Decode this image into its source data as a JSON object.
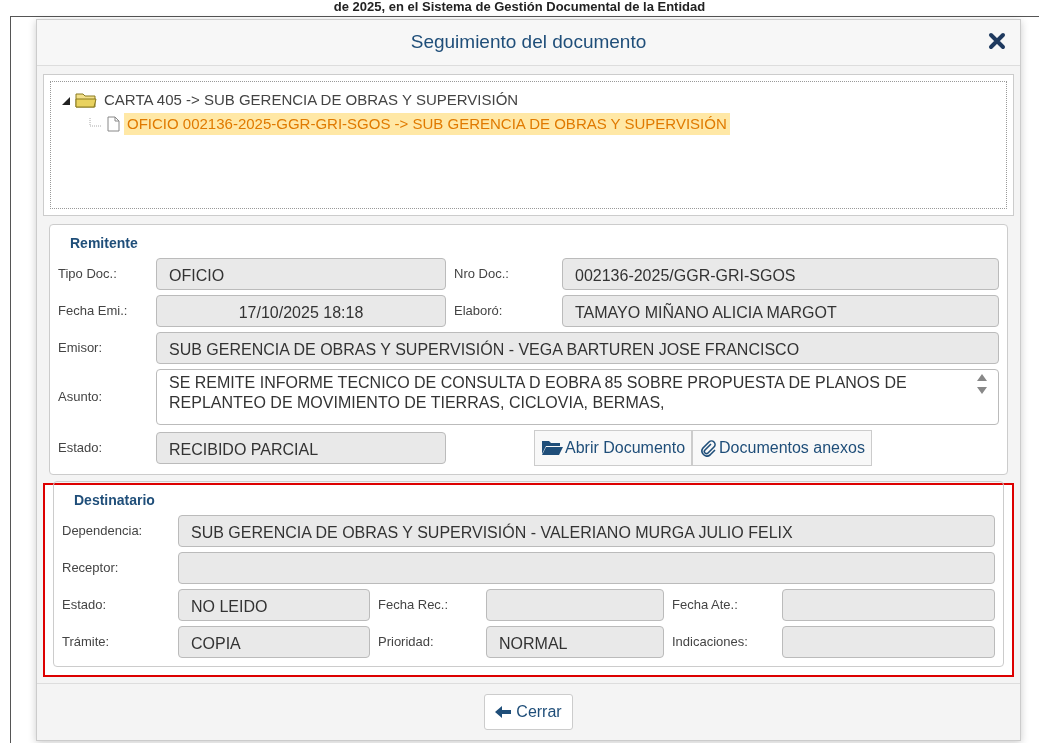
{
  "page_heading": "de 2025, en el Sistema de Gestión Documental de la Entidad",
  "modal": {
    "title": "Seguimiento del documento"
  },
  "tree": [
    {
      "label": "CARTA 405 -> SUB GERENCIA DE OBRAS Y SUPERVISIÓN",
      "expanded": true,
      "selected": false,
      "children": [
        {
          "label": "OFICIO 002136-2025-GGR-GRI-SGOS -> SUB GERENCIA DE OBRAS Y SUPERVISIÓN",
          "selected": true
        }
      ]
    }
  ],
  "remitente": {
    "legend": "Remitente",
    "fields": [
      {
        "kind": "half",
        "label": "Tipo Doc.:",
        "value": "OFICIO"
      },
      {
        "kind": "half",
        "label": "Nro Doc.:",
        "value": "002136-2025/GGR-GRI-SGOS"
      },
      {
        "kind": "date",
        "label": "Fecha Emi.:",
        "value": "17/10/2025 18:18"
      },
      {
        "kind": "half",
        "label": "Elaboró:",
        "value": "TAMAYO MIÑANO ALICIA MARGOT"
      },
      {
        "kind": "full",
        "label": "Emisor:",
        "value": "SUB GERENCIA DE OBRAS Y SUPERVISIÓN - VEGA BARTUREN JOSE FRANCISCO"
      },
      {
        "kind": "textarea",
        "label": "Asunto:",
        "value": "SE REMITE INFORME TECNICO DE CONSULTA D EOBRA 85 SOBRE PROPUESTA DE PLANOS DE REPLANTEO DE MOVIMIENTO DE TIERRAS, CICLOVIA, BERMAS,"
      },
      {
        "kind": "half",
        "label": "Estado:",
        "value": "RECIBIDO PARCIAL"
      }
    ],
    "buttons": [
      {
        "kind": "folder",
        "label": "Abrir Documento"
      },
      {
        "kind": "paperclip",
        "label": "Documentos anexos"
      }
    ]
  },
  "destinatario": {
    "legend": "Destinatario",
    "highlighted": true,
    "fields": [
      {
        "kind": "full",
        "label": "Dependencia:",
        "value": "SUB GERENCIA DE OBRAS Y SUPERVISIÓN - VALERIANO MURGA JULIO FELIX"
      },
      {
        "kind": "full",
        "label": "Receptor:"
      },
      {
        "kind": "third",
        "label": "Estado:",
        "value": "NO LEIDO"
      },
      {
        "kind": "third",
        "label": "Fecha Rec.:"
      },
      {
        "kind": "third",
        "label": "Fecha Ate.:"
      },
      {
        "kind": "third",
        "label": "Trámite:",
        "value": "COPIA"
      },
      {
        "kind": "third",
        "label": "Prioridad:",
        "value": "NORMAL"
      },
      {
        "kind": "third",
        "label": "Indicaciones:"
      }
    ]
  },
  "footer": {
    "button": "Cerrar"
  }
}
